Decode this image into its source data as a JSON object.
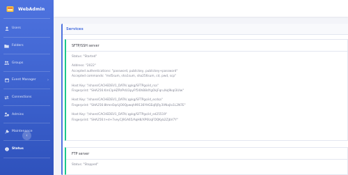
{
  "app": {
    "title": "WebAdmin"
  },
  "sidebar": {
    "items": [
      {
        "label": "Users",
        "icon": "user-icon"
      },
      {
        "label": "Folders",
        "icon": "folder-icon"
      },
      {
        "label": "Groups",
        "icon": "users-icon"
      },
      {
        "label": "Event Manager",
        "icon": "calendar-icon",
        "has_caret": true
      },
      {
        "label": "Connections",
        "icon": "exchange-icon"
      },
      {
        "label": "Admins",
        "icon": "user-shield-icon"
      },
      {
        "label": "Maintenance",
        "icon": "wrench-icon"
      },
      {
        "label": "Status",
        "icon": "info-icon",
        "active": true
      }
    ],
    "toggle_icon": "chevron-left-icon"
  },
  "main": {
    "card_title": "Services",
    "sftp": {
      "name": "SFTP/SSH server",
      "status": "Status: \"Started\"",
      "address": "Address: \"2022\"",
      "auth": "Accepted authentications: \"password, publickey, publickey+password\"",
      "commands": "Accepted commands: \"md5sum, sha1sum, sha256sum, cd, pwd, scp\"",
      "keys": [
        {
          "host": "Host Key: \"/share/CACHEDEV1_DATA/.qpkg/SFTPgo/id_rsa\"",
          "fp": "Fingerprint: \"SHA256:KmClpHZRVPdU3pyFf5l0hB8dYgOkjFqruXeJ9kqI3UIw\""
        },
        {
          "host": "Host Key: \"/share/CACHEDEV1_DATA/.qpkg/SFTPgo/id_ecdsa\"",
          "fp": "Fingerprint: \"SHA256:8tmnOqrLJO0Qpwqh99136YHGEqRjRy3VNajIo1L2N7E\""
        },
        {
          "host": "Host Key: \"/share/CACHEDEV1_DATA/.qpkg/SFTPgo/id_ed25519\"",
          "fp": "Fingerprint: \"SHA256:t+d+7veyCj9GA65/AqH8/XP6UqFDQKyb2ZjbV7Y\""
        }
      ]
    },
    "ftp": {
      "name": "FTP server",
      "status": "Status: \"Stopped\""
    }
  },
  "colors": {
    "sidebar": "#4e73df",
    "accent": "#4e73df",
    "ok_border": "#1cc88a"
  }
}
